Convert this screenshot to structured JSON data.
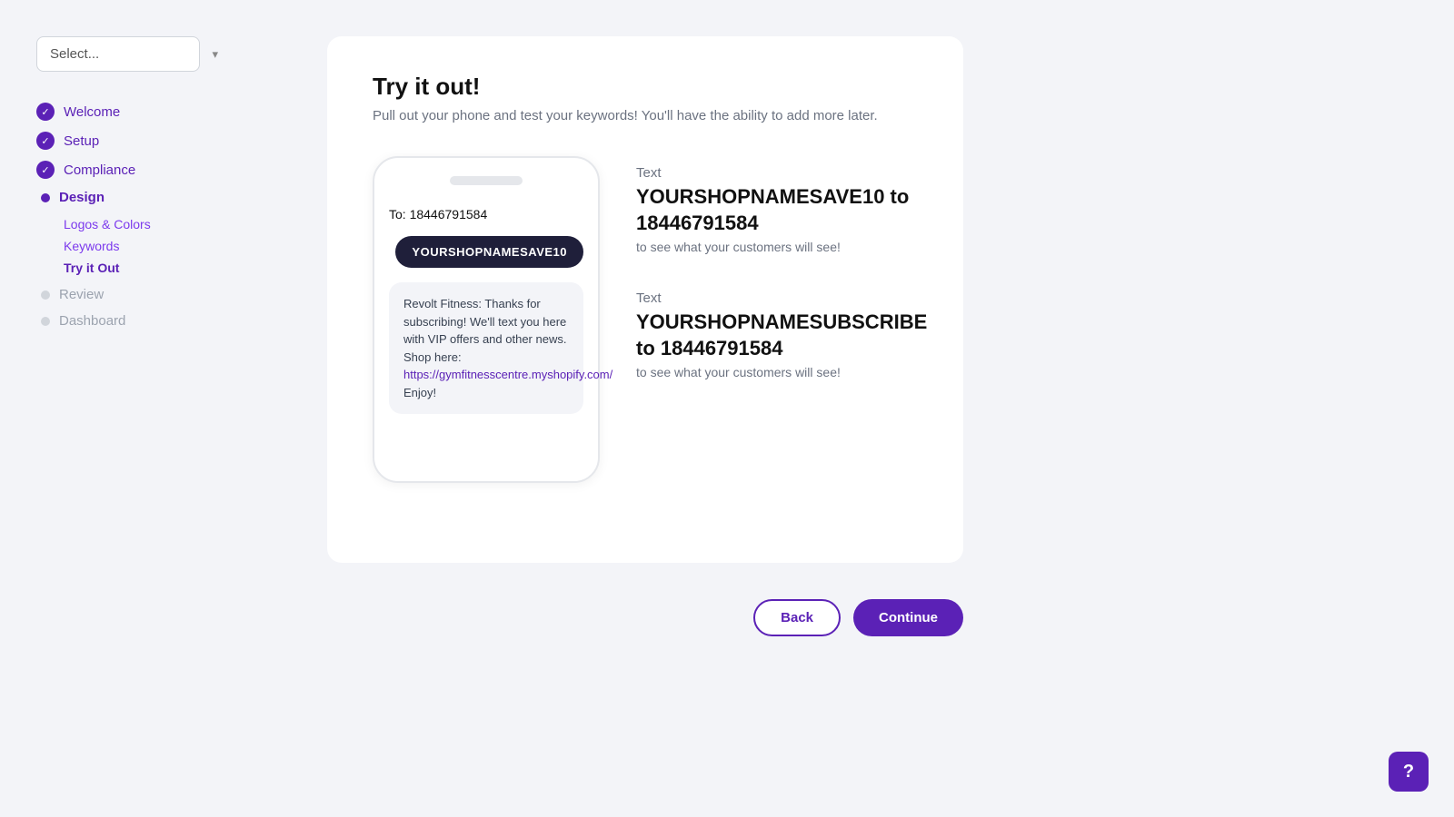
{
  "sidebar": {
    "select_placeholder": "Select...",
    "nav_items": [
      {
        "id": "welcome",
        "label": "Welcome",
        "state": "completed"
      },
      {
        "id": "setup",
        "label": "Setup",
        "state": "completed"
      },
      {
        "id": "compliance",
        "label": "Compliance",
        "state": "completed"
      },
      {
        "id": "design",
        "label": "Design",
        "state": "active",
        "subnav": [
          {
            "id": "logos-colors",
            "label": "Logos & Colors",
            "state": "sub"
          },
          {
            "id": "keywords",
            "label": "Keywords",
            "state": "sub"
          },
          {
            "id": "try-it-out",
            "label": "Try it Out",
            "state": "active-sub"
          }
        ]
      },
      {
        "id": "review",
        "label": "Review",
        "state": "inactive"
      },
      {
        "id": "dashboard",
        "label": "Dashboard",
        "state": "inactive"
      }
    ]
  },
  "main": {
    "title": "Try it out!",
    "subtitle": "Pull out your phone and test your keywords! You'll have the ability to add more later.",
    "phone": {
      "to_label": "To:",
      "to_number": "18446791584",
      "keyword_bubble": "YOURSHOPNAMESAVE10",
      "response_text": "Revolt Fitness: Thanks for subscribing! We'll text you here with VIP offers and other news. Shop here: ",
      "response_link": "https://gymfitnesscentre.myshopify.com/",
      "response_suffix": " Enjoy!"
    },
    "instruction1": {
      "text_label": "Text",
      "keyword": "YOURSHOPNAMESAVE10 to 18446791584",
      "sub": "to see what your customers will see!"
    },
    "instruction2": {
      "text_label": "Text",
      "keyword": "YOURSHOPNAMESUBSCRIBE to 18446791584",
      "sub": "to see what your customers will see!"
    },
    "buttons": {
      "back": "Back",
      "continue": "Continue"
    }
  },
  "help": {
    "icon": "?"
  }
}
